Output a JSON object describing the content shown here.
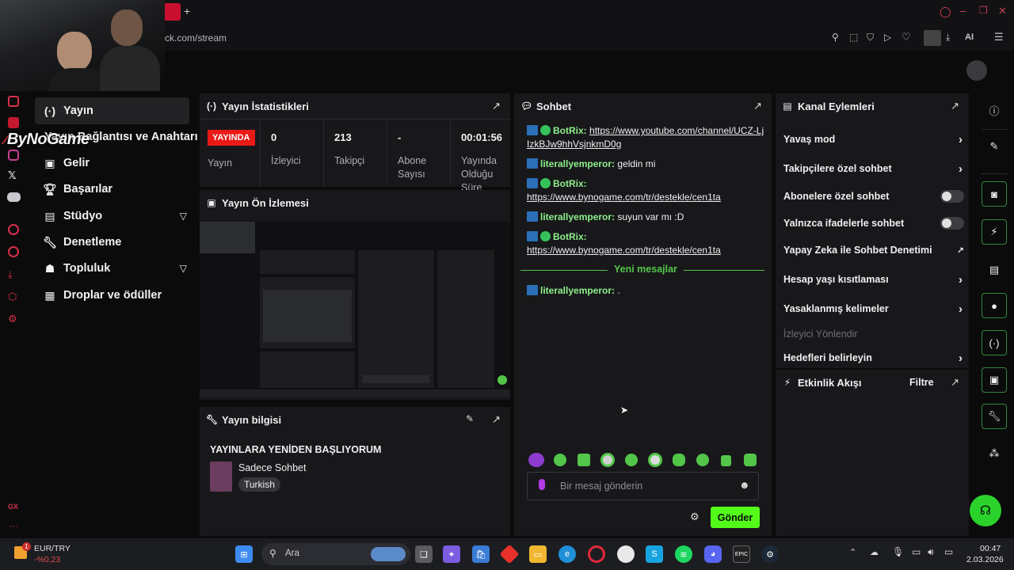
{
  "browser": {
    "tab_close": "✕",
    "url_text": "ck.com/stream",
    "ai_label": "AI"
  },
  "brand_overlay": "ByNoGame",
  "nav": {
    "items": [
      {
        "label": "Yayın",
        "icon": "broadcast-icon"
      },
      {
        "label": "Yayın Bağlantısı ve Anahtarı",
        "icon": "key-icon"
      },
      {
        "label": "Gelir",
        "icon": "revenue-icon"
      },
      {
        "label": "Başarılar",
        "icon": "trophy-icon"
      },
      {
        "label": "Stüdyo",
        "icon": "studio-icon"
      },
      {
        "label": "Denetleme",
        "icon": "wrench-icon"
      },
      {
        "label": "Topluluk",
        "icon": "community-icon"
      },
      {
        "label": "Droplar ve ödüller",
        "icon": "drops-icon"
      }
    ],
    "gx_label": "GX"
  },
  "stats": {
    "title": "Yayın İstatistikleri",
    "live_badge": "YAYINDA",
    "live_label": "Yayın",
    "viewers_value": "0",
    "viewers_label": "İzleyici",
    "followers_value": "213",
    "followers_label": "Takipçi",
    "subs_value": "-",
    "subs_label": "Abone Sayısı",
    "uptime_value": "00:01:56",
    "uptime_label": "Yayında Olduğu Süre"
  },
  "preview": {
    "title": "Yayın Ön İzlemesi"
  },
  "info": {
    "title": "Yayın bilgisi",
    "stream_title": "YAYINLARA YENİDEN BAŞLIYORUM",
    "category": "Sadece Sohbet",
    "tag": "Turkish"
  },
  "chat": {
    "title": "Sohbet",
    "messages": [
      {
        "user": "BotRix:",
        "text": "https://www.youtube.com/channel/UCZ-LjIzkBJw9hhVsjnkmD0g"
      },
      {
        "user": "literallyemperor:",
        "text": "geldin mi"
      },
      {
        "user": "BotRix:",
        "text": "https://www.bynogame.com/tr/destekle/cen1ta"
      },
      {
        "user": "literallyemperor:",
        "text": "suyun var mı :D"
      },
      {
        "user": "BotRix:",
        "text": "https://www.bynogame.com/tr/destekle/cen1ta"
      },
      {
        "user": "literallyemperor:",
        "text": "."
      }
    ],
    "new_messages": "Yeni mesajlar",
    "input_placeholder": "Bir mesaj gönderin",
    "send_label": "Gönder"
  },
  "kanal": {
    "title": "Kanal Eylemleri",
    "rows": [
      {
        "label": "Yavaş mod",
        "control": "chevron"
      },
      {
        "label": "Takipçilere özel sohbet",
        "control": "chevron"
      },
      {
        "label": "Abonelere özel sohbet",
        "control": "toggle"
      },
      {
        "label": "Yalnızca ifadelerle sohbet",
        "control": "toggle"
      },
      {
        "label": "Yapay Zeka ile Sohbet Denetimi",
        "control": "external"
      },
      {
        "label": "Hesap yaşı kısıtlaması",
        "control": "chevron"
      },
      {
        "label": "Yasaklanmış kelimeler",
        "control": "chevron"
      },
      {
        "label": "İzleyici Yönlendir",
        "control": "none"
      },
      {
        "label": "Hedefleri belirleyin",
        "control": "chevron"
      }
    ]
  },
  "activity": {
    "title": "Etkinlik Akışı",
    "filter": "Filtre"
  },
  "taskbar": {
    "currency_pair": "EUR/TRY",
    "currency_change": "-%0,23",
    "currency_badge": "1",
    "search_label": "Ara",
    "time": "00:47",
    "date": "2.03.2026"
  },
  "colors": {
    "accent_green": "#53fc18",
    "live_red": "#e91916",
    "panel_bg": "#18181b",
    "background": "#0b0b0c"
  }
}
